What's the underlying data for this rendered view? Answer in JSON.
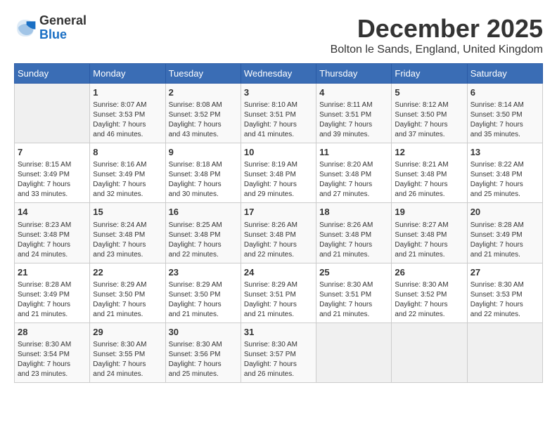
{
  "header": {
    "logo": {
      "general": "General",
      "blue": "Blue"
    },
    "title": "December 2025",
    "location": "Bolton le Sands, England, United Kingdom"
  },
  "calendar": {
    "days_of_week": [
      "Sunday",
      "Monday",
      "Tuesday",
      "Wednesday",
      "Thursday",
      "Friday",
      "Saturday"
    ],
    "weeks": [
      [
        {
          "day": "",
          "info": ""
        },
        {
          "day": "1",
          "info": "Sunrise: 8:07 AM\nSunset: 3:53 PM\nDaylight: 7 hours\nand 46 minutes."
        },
        {
          "day": "2",
          "info": "Sunrise: 8:08 AM\nSunset: 3:52 PM\nDaylight: 7 hours\nand 43 minutes."
        },
        {
          "day": "3",
          "info": "Sunrise: 8:10 AM\nSunset: 3:51 PM\nDaylight: 7 hours\nand 41 minutes."
        },
        {
          "day": "4",
          "info": "Sunrise: 8:11 AM\nSunset: 3:51 PM\nDaylight: 7 hours\nand 39 minutes."
        },
        {
          "day": "5",
          "info": "Sunrise: 8:12 AM\nSunset: 3:50 PM\nDaylight: 7 hours\nand 37 minutes."
        },
        {
          "day": "6",
          "info": "Sunrise: 8:14 AM\nSunset: 3:50 PM\nDaylight: 7 hours\nand 35 minutes."
        }
      ],
      [
        {
          "day": "7",
          "info": "Sunrise: 8:15 AM\nSunset: 3:49 PM\nDaylight: 7 hours\nand 33 minutes."
        },
        {
          "day": "8",
          "info": "Sunrise: 8:16 AM\nSunset: 3:49 PM\nDaylight: 7 hours\nand 32 minutes."
        },
        {
          "day": "9",
          "info": "Sunrise: 8:18 AM\nSunset: 3:48 PM\nDaylight: 7 hours\nand 30 minutes."
        },
        {
          "day": "10",
          "info": "Sunrise: 8:19 AM\nSunset: 3:48 PM\nDaylight: 7 hours\nand 29 minutes."
        },
        {
          "day": "11",
          "info": "Sunrise: 8:20 AM\nSunset: 3:48 PM\nDaylight: 7 hours\nand 27 minutes."
        },
        {
          "day": "12",
          "info": "Sunrise: 8:21 AM\nSunset: 3:48 PM\nDaylight: 7 hours\nand 26 minutes."
        },
        {
          "day": "13",
          "info": "Sunrise: 8:22 AM\nSunset: 3:48 PM\nDaylight: 7 hours\nand 25 minutes."
        }
      ],
      [
        {
          "day": "14",
          "info": "Sunrise: 8:23 AM\nSunset: 3:48 PM\nDaylight: 7 hours\nand 24 minutes."
        },
        {
          "day": "15",
          "info": "Sunrise: 8:24 AM\nSunset: 3:48 PM\nDaylight: 7 hours\nand 23 minutes."
        },
        {
          "day": "16",
          "info": "Sunrise: 8:25 AM\nSunset: 3:48 PM\nDaylight: 7 hours\nand 22 minutes."
        },
        {
          "day": "17",
          "info": "Sunrise: 8:26 AM\nSunset: 3:48 PM\nDaylight: 7 hours\nand 22 minutes."
        },
        {
          "day": "18",
          "info": "Sunrise: 8:26 AM\nSunset: 3:48 PM\nDaylight: 7 hours\nand 21 minutes."
        },
        {
          "day": "19",
          "info": "Sunrise: 8:27 AM\nSunset: 3:48 PM\nDaylight: 7 hours\nand 21 minutes."
        },
        {
          "day": "20",
          "info": "Sunrise: 8:28 AM\nSunset: 3:49 PM\nDaylight: 7 hours\nand 21 minutes."
        }
      ],
      [
        {
          "day": "21",
          "info": "Sunrise: 8:28 AM\nSunset: 3:49 PM\nDaylight: 7 hours\nand 21 minutes."
        },
        {
          "day": "22",
          "info": "Sunrise: 8:29 AM\nSunset: 3:50 PM\nDaylight: 7 hours\nand 21 minutes."
        },
        {
          "day": "23",
          "info": "Sunrise: 8:29 AM\nSunset: 3:50 PM\nDaylight: 7 hours\nand 21 minutes."
        },
        {
          "day": "24",
          "info": "Sunrise: 8:29 AM\nSunset: 3:51 PM\nDaylight: 7 hours\nand 21 minutes."
        },
        {
          "day": "25",
          "info": "Sunrise: 8:30 AM\nSunset: 3:51 PM\nDaylight: 7 hours\nand 21 minutes."
        },
        {
          "day": "26",
          "info": "Sunrise: 8:30 AM\nSunset: 3:52 PM\nDaylight: 7 hours\nand 22 minutes."
        },
        {
          "day": "27",
          "info": "Sunrise: 8:30 AM\nSunset: 3:53 PM\nDaylight: 7 hours\nand 22 minutes."
        }
      ],
      [
        {
          "day": "28",
          "info": "Sunrise: 8:30 AM\nSunset: 3:54 PM\nDaylight: 7 hours\nand 23 minutes."
        },
        {
          "day": "29",
          "info": "Sunrise: 8:30 AM\nSunset: 3:55 PM\nDaylight: 7 hours\nand 24 minutes."
        },
        {
          "day": "30",
          "info": "Sunrise: 8:30 AM\nSunset: 3:56 PM\nDaylight: 7 hours\nand 25 minutes."
        },
        {
          "day": "31",
          "info": "Sunrise: 8:30 AM\nSunset: 3:57 PM\nDaylight: 7 hours\nand 26 minutes."
        },
        {
          "day": "",
          "info": ""
        },
        {
          "day": "",
          "info": ""
        },
        {
          "day": "",
          "info": ""
        }
      ]
    ]
  }
}
